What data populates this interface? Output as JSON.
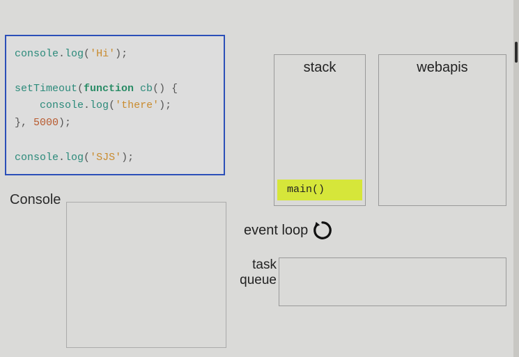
{
  "code": {
    "line1": {
      "obj": "console",
      "dot": ".",
      "method": "log",
      "open": "(",
      "str": "'Hi'",
      "close": ");"
    },
    "line2": {
      "fn": "setTimeout",
      "open": "(",
      "kw": "function",
      "name": " cb",
      "args": "() {"
    },
    "line3": {
      "indent": "    ",
      "obj": "console",
      "dot": ".",
      "method": "log",
      "open": "(",
      "str": "'there'",
      "close": ");"
    },
    "line4": {
      "close1": "}, ",
      "num": "5000",
      "close2": ");"
    },
    "line5": {
      "obj": "console",
      "dot": ".",
      "method": "log",
      "open": "(",
      "str": "'SJS'",
      "close": ");"
    }
  },
  "labels": {
    "console": "Console",
    "stack": "stack",
    "webapis": "webapis",
    "event_loop": "event loop",
    "task_queue_1": "task",
    "task_queue_2": "queue"
  },
  "stack": {
    "frame0": "main()"
  }
}
